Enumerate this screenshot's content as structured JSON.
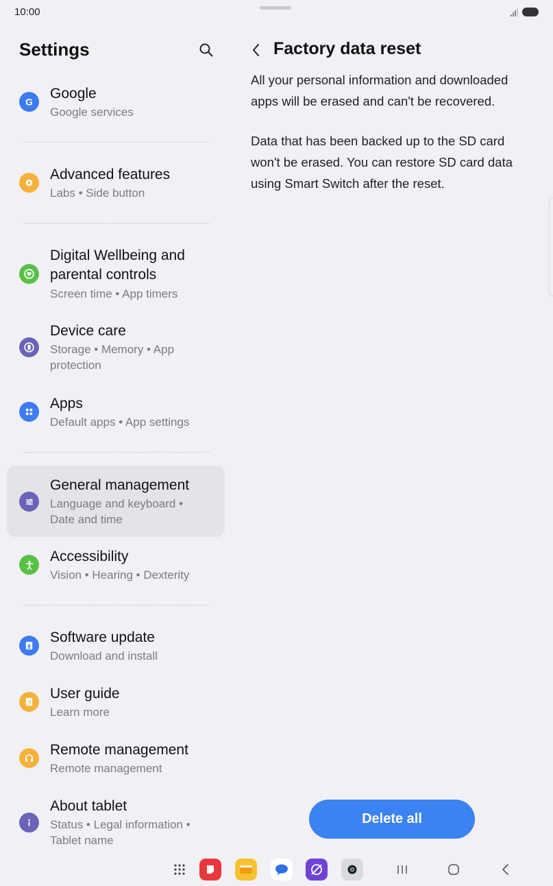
{
  "status": {
    "time": "10:00"
  },
  "settings": {
    "title": "Settings",
    "items": [
      {
        "title": "Google",
        "subtitle": "Google services",
        "icon": "google-icon",
        "color": "#3d7bf0"
      },
      {
        "title": "Advanced features",
        "subtitle": "Labs  •  Side button",
        "icon": "gear-plus-icon",
        "color": "#f5b23b"
      },
      {
        "title": "Digital Wellbeing and",
        "title2": "parental controls",
        "subtitle": "Screen time  •  App timers",
        "icon": "wellbeing-heart-icon",
        "color": "#59c046"
      },
      {
        "title": "Device care",
        "subtitle": "Storage  •  Memory  •  App",
        "subtitle2": "protection",
        "icon": "device-care-icon",
        "color": "#6a63b8"
      },
      {
        "title": "Apps",
        "subtitle": "Default apps  •  App settings",
        "icon": "apps-grid-icon",
        "color": "#3d7bf0"
      },
      {
        "title": "General management",
        "subtitle": "Language and keyboard  •",
        "subtitle2": "Date and time",
        "icon": "sliders-icon",
        "color": "#6a63b8"
      },
      {
        "title": "Accessibility",
        "subtitle": "Vision  •  Hearing  •  Dexterity",
        "icon": "accessibility-icon",
        "color": "#59c046"
      },
      {
        "title": "Software update",
        "subtitle": "Download and install",
        "icon": "software-update-icon",
        "color": "#3d7bf0"
      },
      {
        "title": "User guide",
        "subtitle": "Learn more",
        "icon": "user-guide-icon",
        "color": "#f5b23b"
      },
      {
        "title": "Remote management",
        "subtitle": "Remote management",
        "icon": "headset-icon",
        "color": "#f5b23b"
      },
      {
        "title": "About tablet",
        "subtitle": "Status  •  Legal information  •",
        "subtitle2": "Tablet name",
        "icon": "info-icon",
        "color": "#6a63b8"
      }
    ]
  },
  "detail": {
    "title": "Factory data reset",
    "paragraph1_line1": "All your personal information and downloaded",
    "paragraph1_line2": "apps will be erased and can't be recovered.",
    "paragraph2_line1": "Data that has been backed up to the SD card",
    "paragraph2_line2": "won't be erased. You can restore SD card data",
    "paragraph2_line3": "using Smart Switch after the reset.",
    "delete_label": "Delete all"
  },
  "taskbar": {
    "apps": [
      "app-drawer-icon",
      "notes-app-icon",
      "my-files-icon",
      "messages-icon",
      "internet-icon",
      "camera-icon"
    ],
    "nav": [
      "recents-icon",
      "home-icon",
      "back-nav-icon"
    ]
  }
}
